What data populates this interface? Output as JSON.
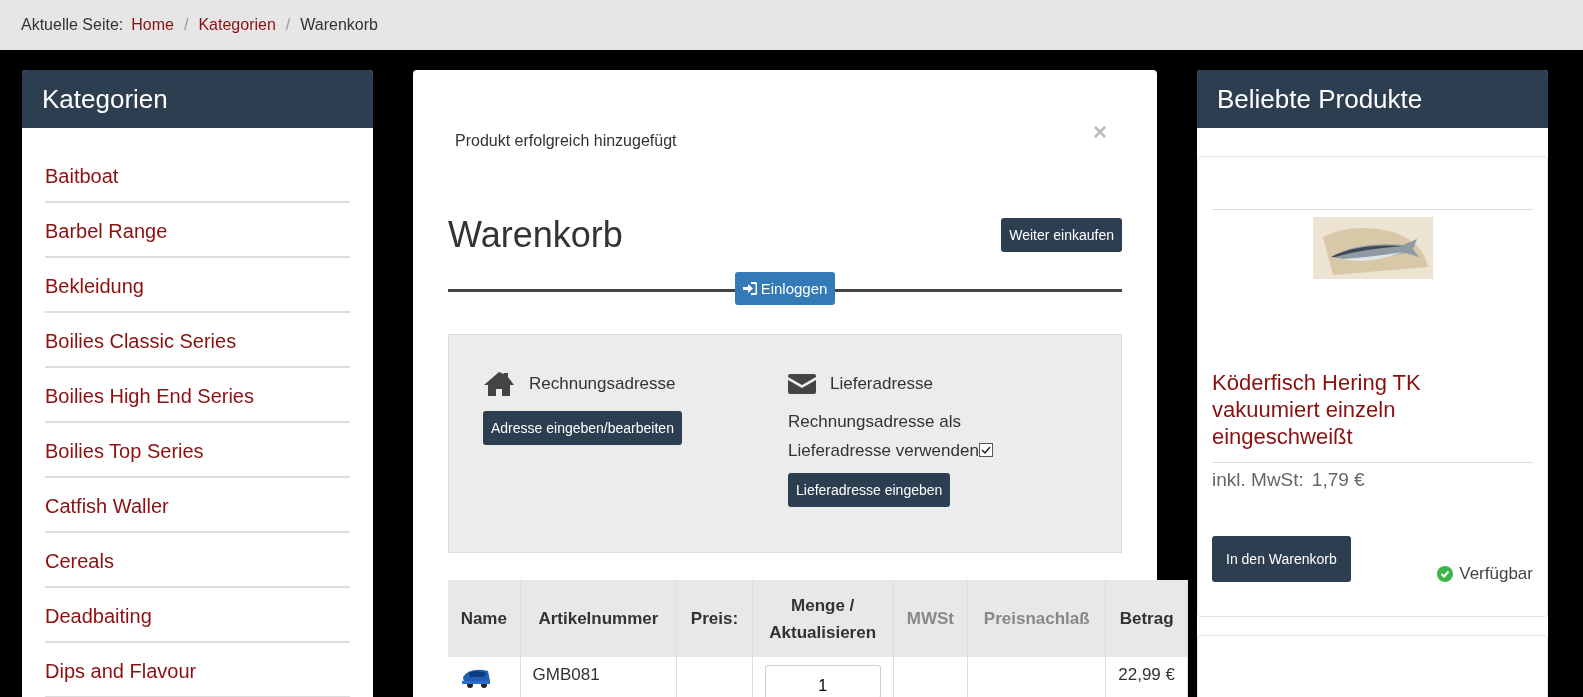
{
  "breadcrumb": {
    "label": "Aktuelle Seite:",
    "separator": "/",
    "items": [
      {
        "text": "Home",
        "kind": "link"
      },
      {
        "text": "Kategorien",
        "kind": "link"
      },
      {
        "text": "Warenkorb",
        "kind": "current"
      }
    ]
  },
  "sidebar": {
    "title": "Kategorien",
    "items": [
      "Baitboat",
      "Barbel Range",
      "Bekleidung",
      "Boilies Classic Series",
      "Boilies High End Series",
      "Boilies Top Series",
      "Catfish Waller",
      "Cereals",
      "Deadbaiting",
      "Dips and Flavour"
    ]
  },
  "modal": {
    "message": "Produkt erfolgreich hinzugefügt",
    "close": "×",
    "title": "Warenkorb",
    "continue_button": "Weiter einkaufen",
    "login_button": "Einloggen",
    "billing": {
      "title": "Rechnungsadresse",
      "button": "Adresse eingeben/bearbeiten"
    },
    "shipping": {
      "title": "Lieferadresse",
      "same_address_label": "Rechnungsadresse als Lieferadresse verwenden",
      "same_address_checked": true,
      "button": "Lieferadresse eingeben"
    },
    "table": {
      "columns": [
        {
          "label": "Name",
          "muted": false
        },
        {
          "label": "Artikelnummer",
          "muted": false
        },
        {
          "label": "Preis:",
          "muted": false
        },
        {
          "label": "Menge / Aktualisieren",
          "muted": false
        },
        {
          "label": "MWSt",
          "muted": true
        },
        {
          "label": "Preisnachlaß",
          "muted": true
        },
        {
          "label": "Betrag",
          "muted": false
        }
      ],
      "rows": [
        {
          "article": "GMB081",
          "quantity": "1",
          "amount": "22,99 €"
        }
      ]
    }
  },
  "popular": {
    "title": "Beliebte Produkte",
    "products": [
      {
        "name": "Köderfisch Hering TK vakuumiert einzeln eingeschweißt",
        "price_label": "inkl. MwSt:",
        "price": "1,79 €",
        "button": "In den Warenkorb",
        "available": true,
        "availability": "Verfügbar"
      }
    ]
  }
}
